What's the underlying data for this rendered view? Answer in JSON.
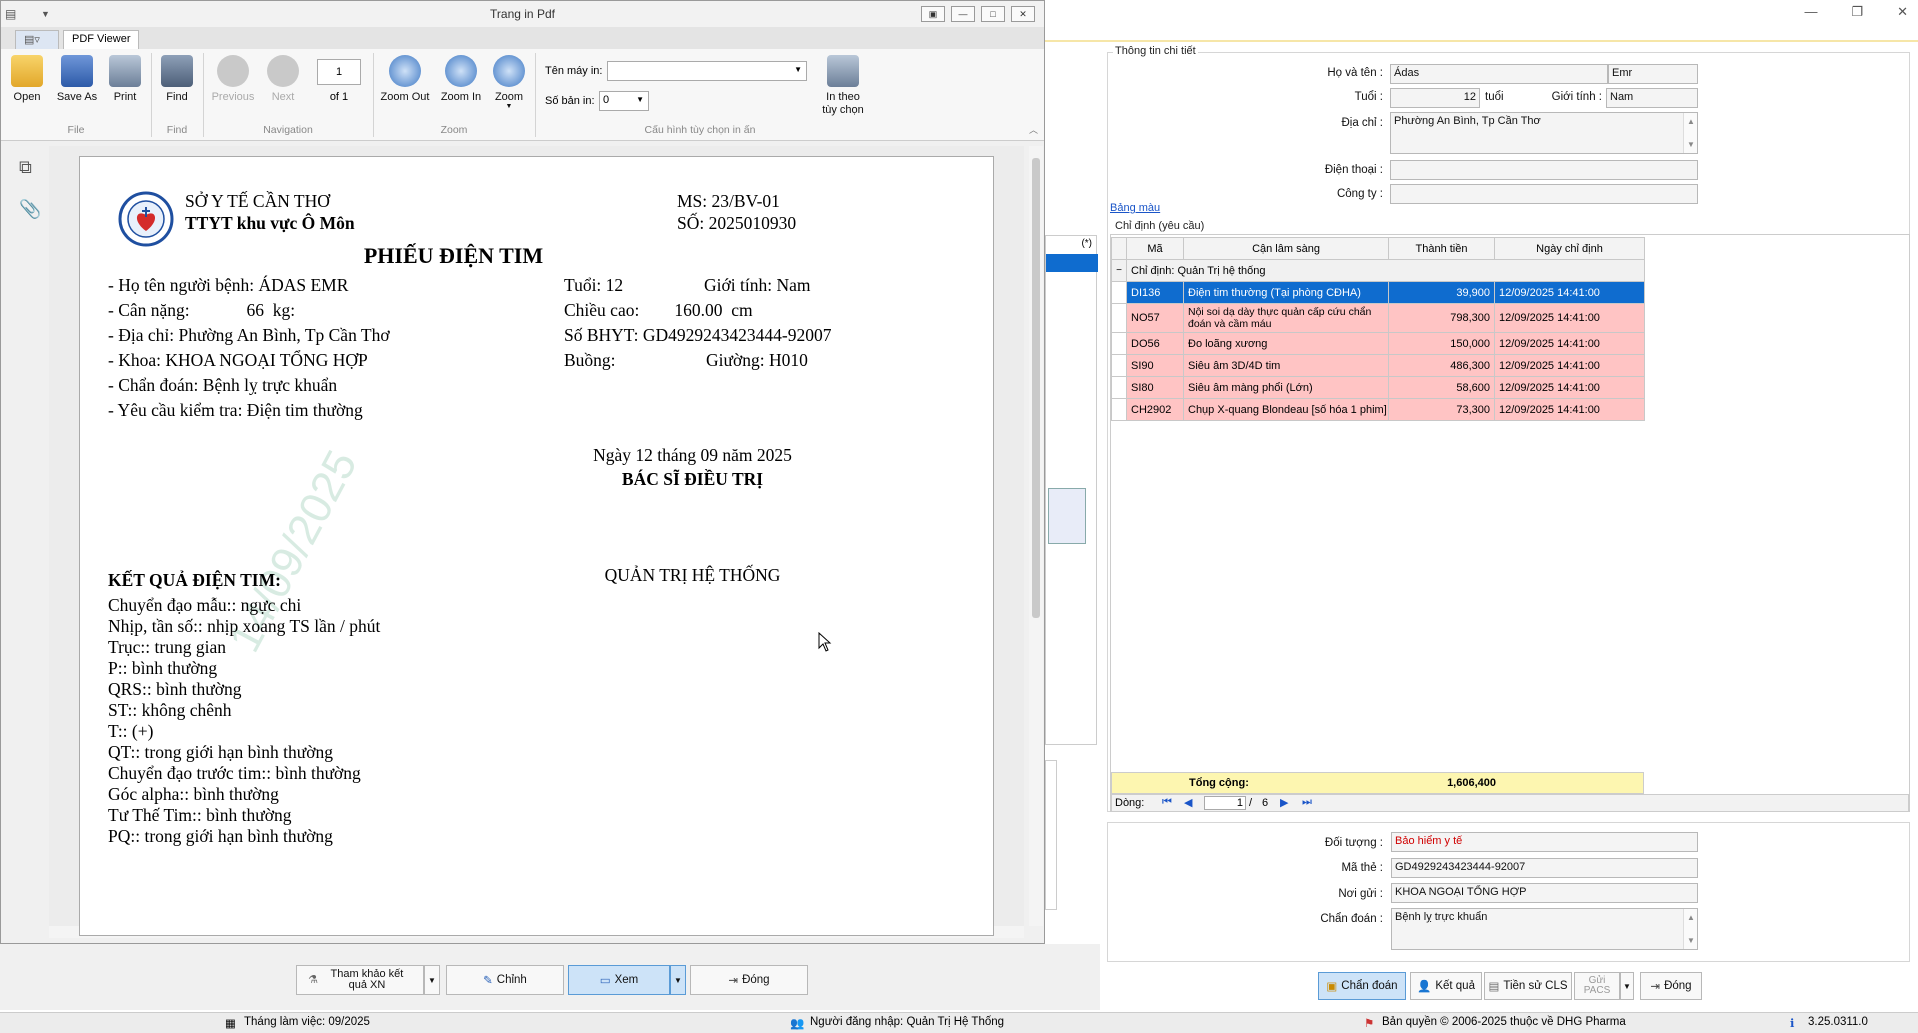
{
  "pdf_window": {
    "title": "Trang in Pdf",
    "tab": "PDF Viewer",
    "ribbon": {
      "open": "Open",
      "save_as": "Save As",
      "print": "Print",
      "find": "Find",
      "previous": "Previous",
      "next": "Next",
      "page_input": "1",
      "of_pages": "of 1",
      "zoom_out": "Zoom Out",
      "zoom_in": "Zoom In",
      "zoom": "Zoom",
      "printer_label": "Tên máy in:",
      "copies_label": "Số bản in:",
      "copies_value": "0",
      "print_options": "In theo tùy chọn",
      "group_file": "File",
      "group_find": "Find",
      "group_navigation": "Navigation",
      "group_zoom": "Zoom",
      "group_print_config": "Cấu hình tùy chọn in ấn"
    }
  },
  "document": {
    "org1": "SỞ Y TẾ CẦN THƠ",
    "org2": "TTYT khu vực Ô Môn",
    "ms": "MS: 23/BV-01",
    "so": "SỐ: 2025010930",
    "title": "PHIẾU ĐIỆN TIM",
    "patient_name": "- Họ tên người bệnh: ÁDAS EMR",
    "weight": "- Cân nặng:             66  kg:",
    "address": "- Địa chỉ: Phường An Bình, Tp Cần Thơ",
    "dept": "- Khoa: KHOA NGOẠI TỔNG HỢP",
    "diagnosis": "- Chẩn đoán: Bệnh lỵ trực khuẩn",
    "request": "- Yêu cầu kiểm tra: Điện tim thường",
    "age": "Tuổi: 12",
    "gender": "Giới tính: Nam",
    "height": "Chiều cao:        160.00  cm",
    "bhyt": "Số BHYT: GD4929243423444-92007",
    "room": "Buồng:",
    "bed": "Giường: H010",
    "date": "Ngày 12 tháng 09 năm 2025",
    "doctor_title": "BÁC SĨ ĐIỀU TRỊ",
    "doctor_name": "QUẢN TRỊ HỆ THỐNG",
    "result_title": "KẾT QUẢ ĐIỆN TIM:",
    "results": [
      "Chuyển đạo mẫu:: ngực chi",
      "Nhịp, tần số:: nhịp xoang TS   lần / phút",
      "Trục:: trung gian",
      "P:: bình thường",
      "QRS:: bình thường",
      "ST:: không chênh",
      "T:: (+)",
      "QT:: trong giới hạn bình thường",
      "Chuyển đạo trước tim:: bình thường",
      "Góc alpha:: bình thường",
      "Tư Thế Tim:: bình thường",
      "PQ:: trong giới hạn bình thường"
    ],
    "watermark": "14/09/2025"
  },
  "bottom_buttons": {
    "tham_khao": "Tham khảo kết quả XN",
    "chinh": "Chỉnh",
    "xem": "Xem",
    "dong": "Đóng"
  },
  "detail": {
    "group_title": "Thông tin chi tiết",
    "name_label": "Họ và tên :",
    "name_first": "Ádas",
    "name_last": "Emr",
    "age_label": "Tuổi :",
    "age_value": "12",
    "age_unit": "tuổi",
    "gender_label": "Giới tính :",
    "gender_value": "Nam",
    "address_label": "Địa chỉ :",
    "address_value": "Phường An Bình, Tp Cần Thơ",
    "phone_label": "Điện thoại :",
    "company_label": "Công ty :",
    "color_link": "Bảng màu",
    "orders_title": "Chỉ định (yêu cầu)"
  },
  "orders": {
    "columns": [
      "Mã",
      "Cận lâm sàng",
      "Thành tiền",
      "Ngày chỉ định"
    ],
    "group_row": "Chỉ định:  Quản Trị hệ thống",
    "rows": [
      {
        "code": "DI136",
        "name": "Điện tim thường (Tại phòng CĐHA)",
        "amount": "39,900",
        "date": "12/09/2025 14:41:00"
      },
      {
        "code": "NO57",
        "name": "Nội soi dạ dày thực quản cấp cứu chẩn đoán và cầm máu",
        "amount": "798,300",
        "date": "12/09/2025 14:41:00"
      },
      {
        "code": "DO56",
        "name": "Đo loãng xương",
        "amount": "150,000",
        "date": "12/09/2025 14:41:00"
      },
      {
        "code": "SI90",
        "name": "Siêu âm 3D/4D tim",
        "amount": "486,300",
        "date": "12/09/2025 14:41:00"
      },
      {
        "code": "SI80",
        "name": "Siêu âm màng phổi (Lớn)",
        "amount": "58,600",
        "date": "12/09/2025 14:41:00"
      },
      {
        "code": "CH2902",
        "name": "Chụp X-quang Blondeau [số hóa 1 phim]",
        "amount": "73,300",
        "date": "12/09/2025 14:41:00"
      }
    ],
    "total_label": "Tổng cộng:",
    "total_value": "1,606,400",
    "nav_label": "Dòng:",
    "nav_current": "1",
    "nav_total": "6"
  },
  "insurance": {
    "subject_label": "Đối tượng :",
    "subject_value": "Bảo hiểm y tế",
    "card_label": "Mã thẻ :",
    "card_value": "GD4929243423444-92007",
    "referral_label": "Nơi gửi :",
    "referral_value": "KHOA NGOẠI TỔNG HỢP",
    "diag_label": "Chẩn đoán :",
    "diag_value": "Bệnh lỵ trực khuẩn"
  },
  "right_buttons": {
    "chan_doan": "Chẩn đoán",
    "ket_qua": "Kết quả",
    "tien_su": "Tiền sử CLS",
    "gui_pacs": "Gửi PACS",
    "dong": "Đóng"
  },
  "background_col_header": "(*)",
  "status": {
    "month": "Tháng làm việc: 09/2025",
    "user": "Người đăng nhập: Quản Trị Hệ Thống",
    "copyright": "Bản quyền © 2006-2025 thuộc về DHG Pharma",
    "version": "3.25.0311.0"
  },
  "colors": {
    "selected_row": "#0f6ccf",
    "pink_row": "#ffc4c4",
    "total_bar": "#fdf6b0",
    "red_text": "#d00000"
  }
}
